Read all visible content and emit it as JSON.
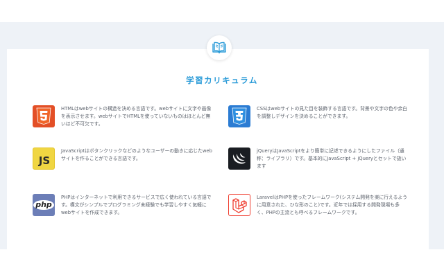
{
  "section": {
    "title": "学習カリキュラム",
    "icon": "open-book-icon"
  },
  "colors": {
    "accent": "#2a9bd8",
    "html5": "#e34f26",
    "css3": "#2b7cd3",
    "javascript": "#f0d642",
    "jquery": "#1a1d22",
    "php": "#6c7eb7",
    "laravel": "#ef3b2d"
  },
  "items": [
    {
      "icon": "html5-logo-icon",
      "description": "HTMLはwebサイトの構造を決める言語です。webサイトに文字や画像を表示させます。webサイトでHTMLを使っていないものはほとんど無いほど不可欠です。"
    },
    {
      "icon": "css3-logo-icon",
      "description": "CSSはwebサイトの見た目を装飾する言語です。背景や文字の色や余白を調整しデザインを決めることができます。"
    },
    {
      "icon": "javascript-logo-icon",
      "logo_text": "JS",
      "description": "JavaScriptはボタンクリックなどのようなユーザーの動きに応じたwebサイトを作ることができる言語です。"
    },
    {
      "icon": "jquery-logo-icon",
      "description": "jQueryはJavaScriptをより簡単に記述できるようにしたファイル（通称：ライブラリ）です。基本的にJavaScript + jQueryとセットで扱います"
    },
    {
      "icon": "php-logo-icon",
      "logo_text": "php",
      "description": "PHPはインターネットで利用できるサービスで広く使われている言語です。構文がシンプルでプログラミング未経験でも学習しやすく気軽にwebサイトを作成できます。"
    },
    {
      "icon": "laravel-logo-icon",
      "description": "LaravelはPHPを使ったフレームワーク(システム開発を楽に行えるように用意された、ひな形のこと)です。近年では採用する開発現場も多く、PHPの主流とも呼べるフレームワークです。"
    }
  ]
}
